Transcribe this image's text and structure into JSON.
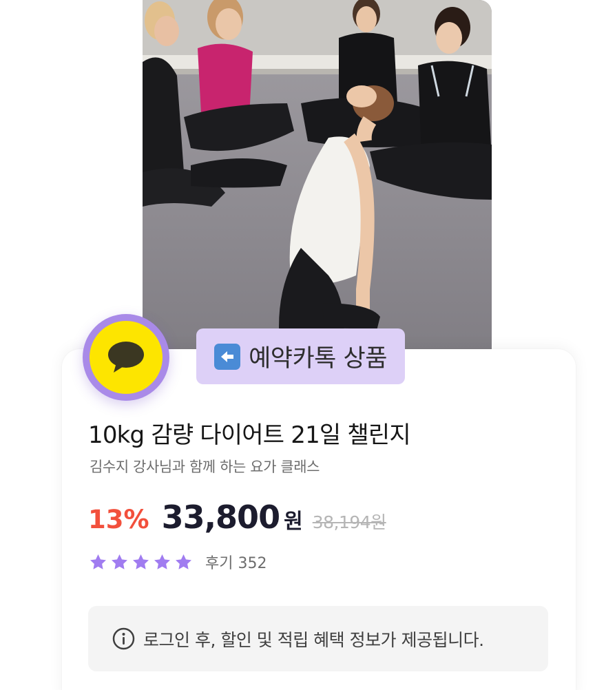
{
  "product": {
    "badge": {
      "icon": "kakaotalk-chat-icon",
      "color": "#fde500",
      "ring_color": "#a98ae8"
    },
    "tag": {
      "icon": "left-arrow-emoji-icon",
      "label": "예약카톡 상품",
      "background": "#ddd0f7"
    },
    "title": "10kg 감량 다이어트 21일 챌린지",
    "subtitle": "김수지 강사님과 함께 하는 요가 클래스",
    "price": {
      "discount": "13%",
      "amount": "33,800",
      "currency": "원",
      "original": "38,194원",
      "discount_color": "#f2503c"
    },
    "rating": {
      "stars": 5,
      "max_stars": 5,
      "star_color": "#a07cf0",
      "review_label": "후기 352"
    },
    "notice": {
      "icon": "info-icon",
      "text": "로그인 후, 할인 및 적립 혜택 정보가 제공됩니다."
    }
  }
}
